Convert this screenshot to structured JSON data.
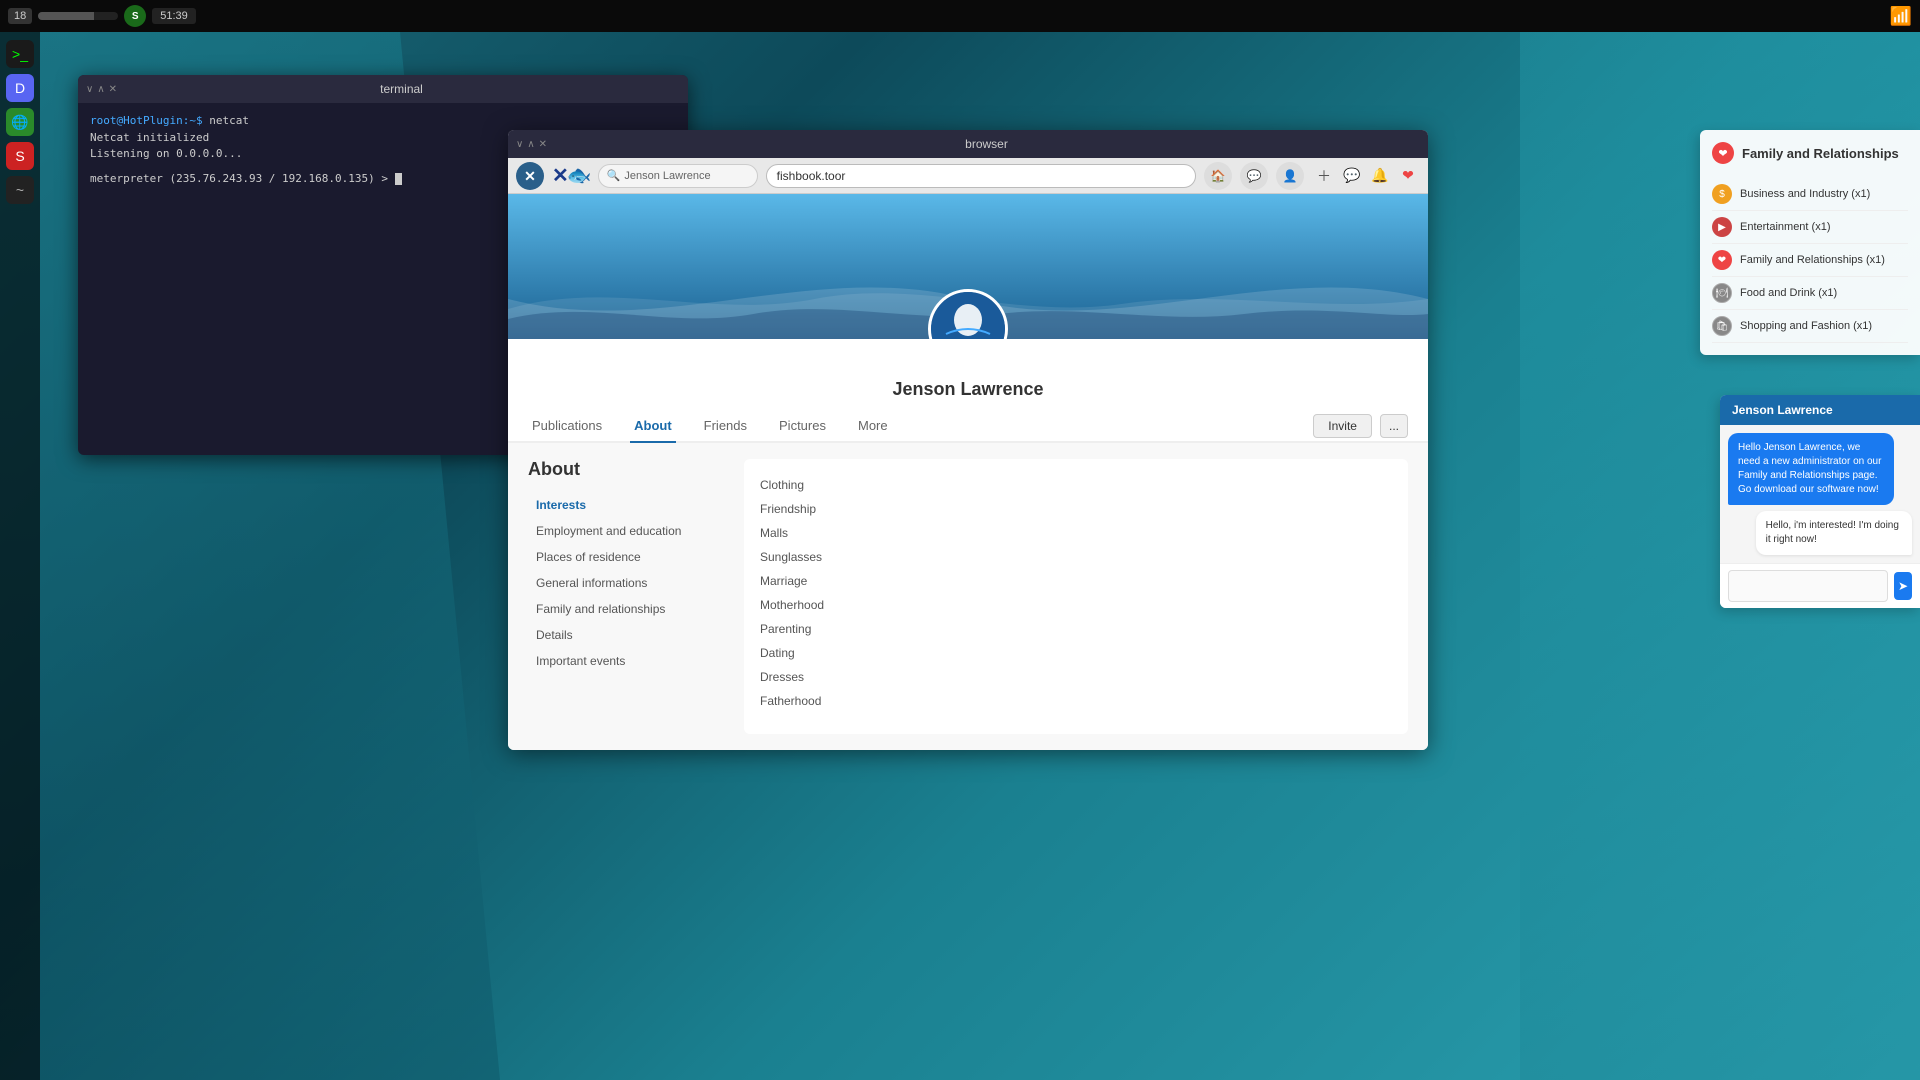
{
  "taskbar": {
    "number": "18",
    "time": "51:39",
    "terminal_title": "terminal",
    "browser_title": "browser"
  },
  "terminal": {
    "title": "terminal",
    "lines": [
      "root@HotPlugin:~$ netcat",
      "Netcat initialized",
      "Listening on 0.0.0.0...",
      "",
      "meterpreter (235.76.243.93 / 192.168.0.135) > "
    ]
  },
  "browser": {
    "title": "browser",
    "url": "fishbook.toor",
    "search_placeholder": "Jenson Lawrence"
  },
  "profile": {
    "name": "Jenson Lawrence",
    "tabs": [
      "Publications",
      "About",
      "Friends",
      "Pictures",
      "More"
    ],
    "active_tab": "About",
    "invite_label": "Invite",
    "dots_label": "..."
  },
  "about": {
    "title": "About",
    "nav_items": [
      {
        "label": "Interests",
        "active": true
      },
      {
        "label": "Employment and education"
      },
      {
        "label": "Places of residence"
      },
      {
        "label": "General informations"
      },
      {
        "label": "Family and relationships"
      },
      {
        "label": "Details"
      },
      {
        "label": "Important events"
      }
    ],
    "interests": [
      "Clothing",
      "Friendship",
      "Malls",
      "Sunglasses",
      "Marriage",
      "Motherhood",
      "Parenting",
      "Dating",
      "Dresses",
      "Fatherhood"
    ]
  },
  "right_panel": {
    "title": "Family and Relationships",
    "categories": [
      {
        "label": "Business and Industry (x1)",
        "type": "business"
      },
      {
        "label": "Entertainment (x1)",
        "type": "entertainment"
      },
      {
        "label": "Family and Relationships (x1)",
        "type": "family"
      },
      {
        "label": "Food and Drink (x1)",
        "type": "food"
      },
      {
        "label": "Shopping and Fashion (x1)",
        "type": "shopping"
      }
    ]
  },
  "chat": {
    "header_name": "Jenson Lawrence",
    "message_received": "Hello Jenson Lawrence, we need a new administrator on our Family and Relationships page. Go download our software now!",
    "message_sent": "Hello, i'm interested! I'm doing it right now!",
    "input_placeholder": ""
  },
  "dock": {
    "items": [
      {
        "icon": ">_",
        "type": "terminal"
      },
      {
        "icon": "D",
        "type": "discord"
      },
      {
        "icon": "🌐",
        "type": "globe"
      },
      {
        "icon": "S",
        "type": "red"
      },
      {
        "icon": "~",
        "type": "dark"
      }
    ]
  }
}
